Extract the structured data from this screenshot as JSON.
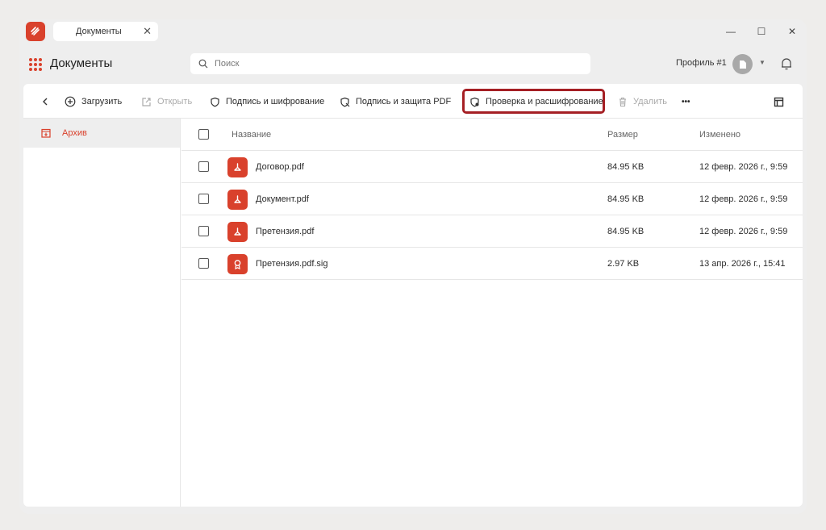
{
  "tab": {
    "title": "Документы",
    "close": "✕"
  },
  "window_controls": {
    "minimize": "—",
    "maximize": "☐",
    "close": "✕"
  },
  "header": {
    "app_title": "Документы",
    "search_placeholder": "Поиск",
    "profile_name": "Профиль #1"
  },
  "toolbar": {
    "upload": "Загрузить",
    "open": "Открыть",
    "sign_encrypt": "Подпись и шифрование",
    "sign_protect_pdf": "Подпись и защита PDF",
    "verify_decrypt": "Проверка и расшифрование",
    "delete": "Удалить",
    "more": "•••"
  },
  "sidebar": {
    "items": [
      {
        "label": "Архив"
      }
    ]
  },
  "table": {
    "columns": {
      "name": "Название",
      "size": "Размер",
      "modified": "Изменено"
    },
    "rows": [
      {
        "name": "Договор.pdf",
        "size": "84.95 KB",
        "modified": "12 февр. 2026 г., 9:59",
        "icon": "pdf-icon"
      },
      {
        "name": "Документ.pdf",
        "size": "84.95 KB",
        "modified": "12 февр. 2026 г., 9:59",
        "icon": "pdf-icon"
      },
      {
        "name": "Претензия.pdf",
        "size": "84.95 KB",
        "modified": "12 февр. 2026 г., 9:59",
        "icon": "pdf-icon"
      },
      {
        "name": "Претензия.pdf.sig",
        "size": "2.97 KB",
        "modified": "13 апр. 2026 г., 15:41",
        "icon": "signature-icon"
      }
    ]
  },
  "colors": {
    "accent": "#d9412c",
    "highlight": "#a51f24",
    "background": "#eeeeee"
  }
}
